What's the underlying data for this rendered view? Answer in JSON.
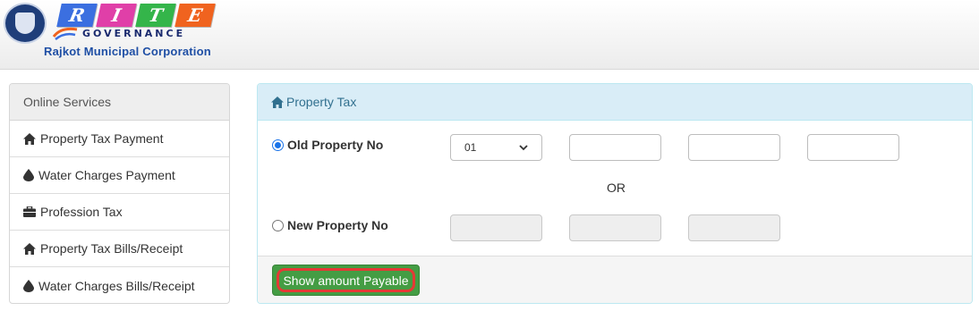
{
  "header": {
    "logo_letters": [
      {
        "char": "R",
        "color": "#3b6fe0"
      },
      {
        "char": "I",
        "color": "#e03fa8"
      },
      {
        "char": "T",
        "color": "#34b54a"
      },
      {
        "char": "E",
        "color": "#f0631f"
      }
    ],
    "tagline": "GOVERNANCE",
    "corporation": "Rajkot Municipal Corporation"
  },
  "sidebar": {
    "heading": "Online Services",
    "items": [
      {
        "label": "Property Tax Payment",
        "icon": "home-icon"
      },
      {
        "label": "Water Charges Payment",
        "icon": "water-drop-icon"
      },
      {
        "label": "Profession Tax",
        "icon": "briefcase-icon"
      },
      {
        "label": "Property Tax Bills/Receipt",
        "icon": "home-icon"
      },
      {
        "label": "Water Charges Bills/Receipt",
        "icon": "water-drop-icon"
      }
    ]
  },
  "panel": {
    "title": "Property Tax",
    "title_icon": "home-icon",
    "old_property_label": "Old Property No",
    "old_property_selected": true,
    "zone_select_value": "01",
    "old_fields": [
      "",
      "",
      ""
    ],
    "or_text": "OR",
    "new_property_label": "New Property No",
    "new_property_selected": false,
    "new_fields": [
      "",
      "",
      ""
    ],
    "submit_label": "Show amount Payable"
  },
  "colors": {
    "panel_heading_bg": "#d9edf7",
    "panel_heading_text": "#31708f",
    "button_bg": "#449d44",
    "button_highlight": "#e53935",
    "corporation_text": "#1f4fa5"
  }
}
